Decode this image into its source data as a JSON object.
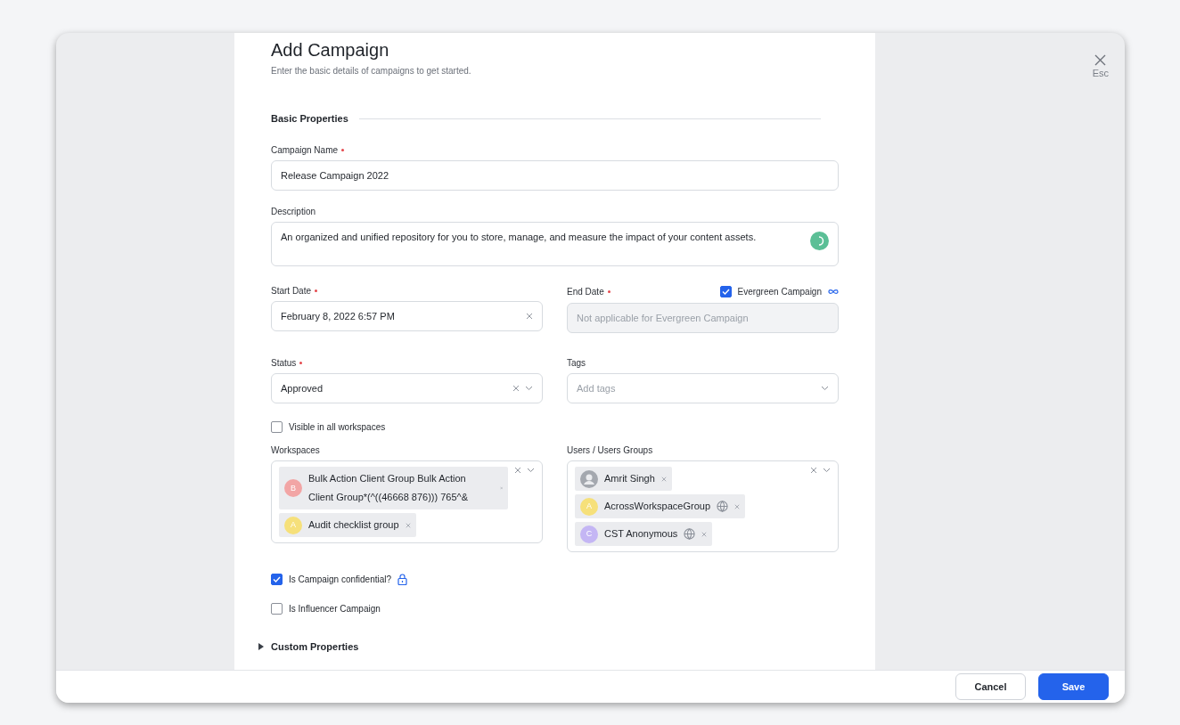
{
  "header": {
    "title": "Add Campaign",
    "subtitle": "Enter the basic details of campaigns to get started."
  },
  "close": {
    "label": "Esc"
  },
  "section": {
    "title": "Basic Properties"
  },
  "campaign_name": {
    "label": "Campaign Name",
    "required": true,
    "value": "Release Campaign 2022"
  },
  "description": {
    "label": "Description",
    "value": "An organized and unified repository for you to store, manage, and measure the impact of your content assets."
  },
  "start_date": {
    "label": "Start Date",
    "required": true,
    "value": "February 8, 2022 6:57 PM"
  },
  "end_date": {
    "label": "End Date",
    "required": true,
    "placeholder": "Not applicable for Evergreen Campaign",
    "disabled": true
  },
  "evergreen": {
    "label": "Evergreen Campaign",
    "checked": true
  },
  "status": {
    "label": "Status",
    "required": true,
    "value": "Approved"
  },
  "tags": {
    "label": "Tags",
    "placeholder": "Add tags"
  },
  "visible_all": {
    "label": "Visible in all workspaces",
    "checked": false
  },
  "workspaces": {
    "label": "Workspaces",
    "chips": [
      {
        "kind": "group",
        "initial": "B",
        "color": "#f2a5a5",
        "label": "Bulk Action Client Group Bulk Action Client Group*(^((46668 876))) 765^&",
        "global": false
      },
      {
        "kind": "group",
        "initial": "A",
        "color": "#f6e07a",
        "label": "Audit checklist group",
        "global": false
      }
    ]
  },
  "users": {
    "label": "Users / Users Groups",
    "chips": [
      {
        "kind": "user",
        "label": "Amrit Singh",
        "global": false
      },
      {
        "kind": "group",
        "initial": "A",
        "color": "#f6e07a",
        "label": "AcrossWorkspaceGroup",
        "global": true
      },
      {
        "kind": "group",
        "initial": "C",
        "color": "#c4b6f4",
        "label": "CST Anonymous",
        "global": true
      }
    ]
  },
  "confidential": {
    "label": "Is Campaign confidential?",
    "checked": true
  },
  "influencer": {
    "label": "Is Influencer Campaign",
    "checked": false
  },
  "custom_properties": {
    "label": "Custom Properties",
    "expanded": false
  },
  "buttons": [
    {
      "kind": "secondary",
      "label": "Cancel"
    },
    {
      "kind": "primary",
      "label": "Save"
    }
  ]
}
